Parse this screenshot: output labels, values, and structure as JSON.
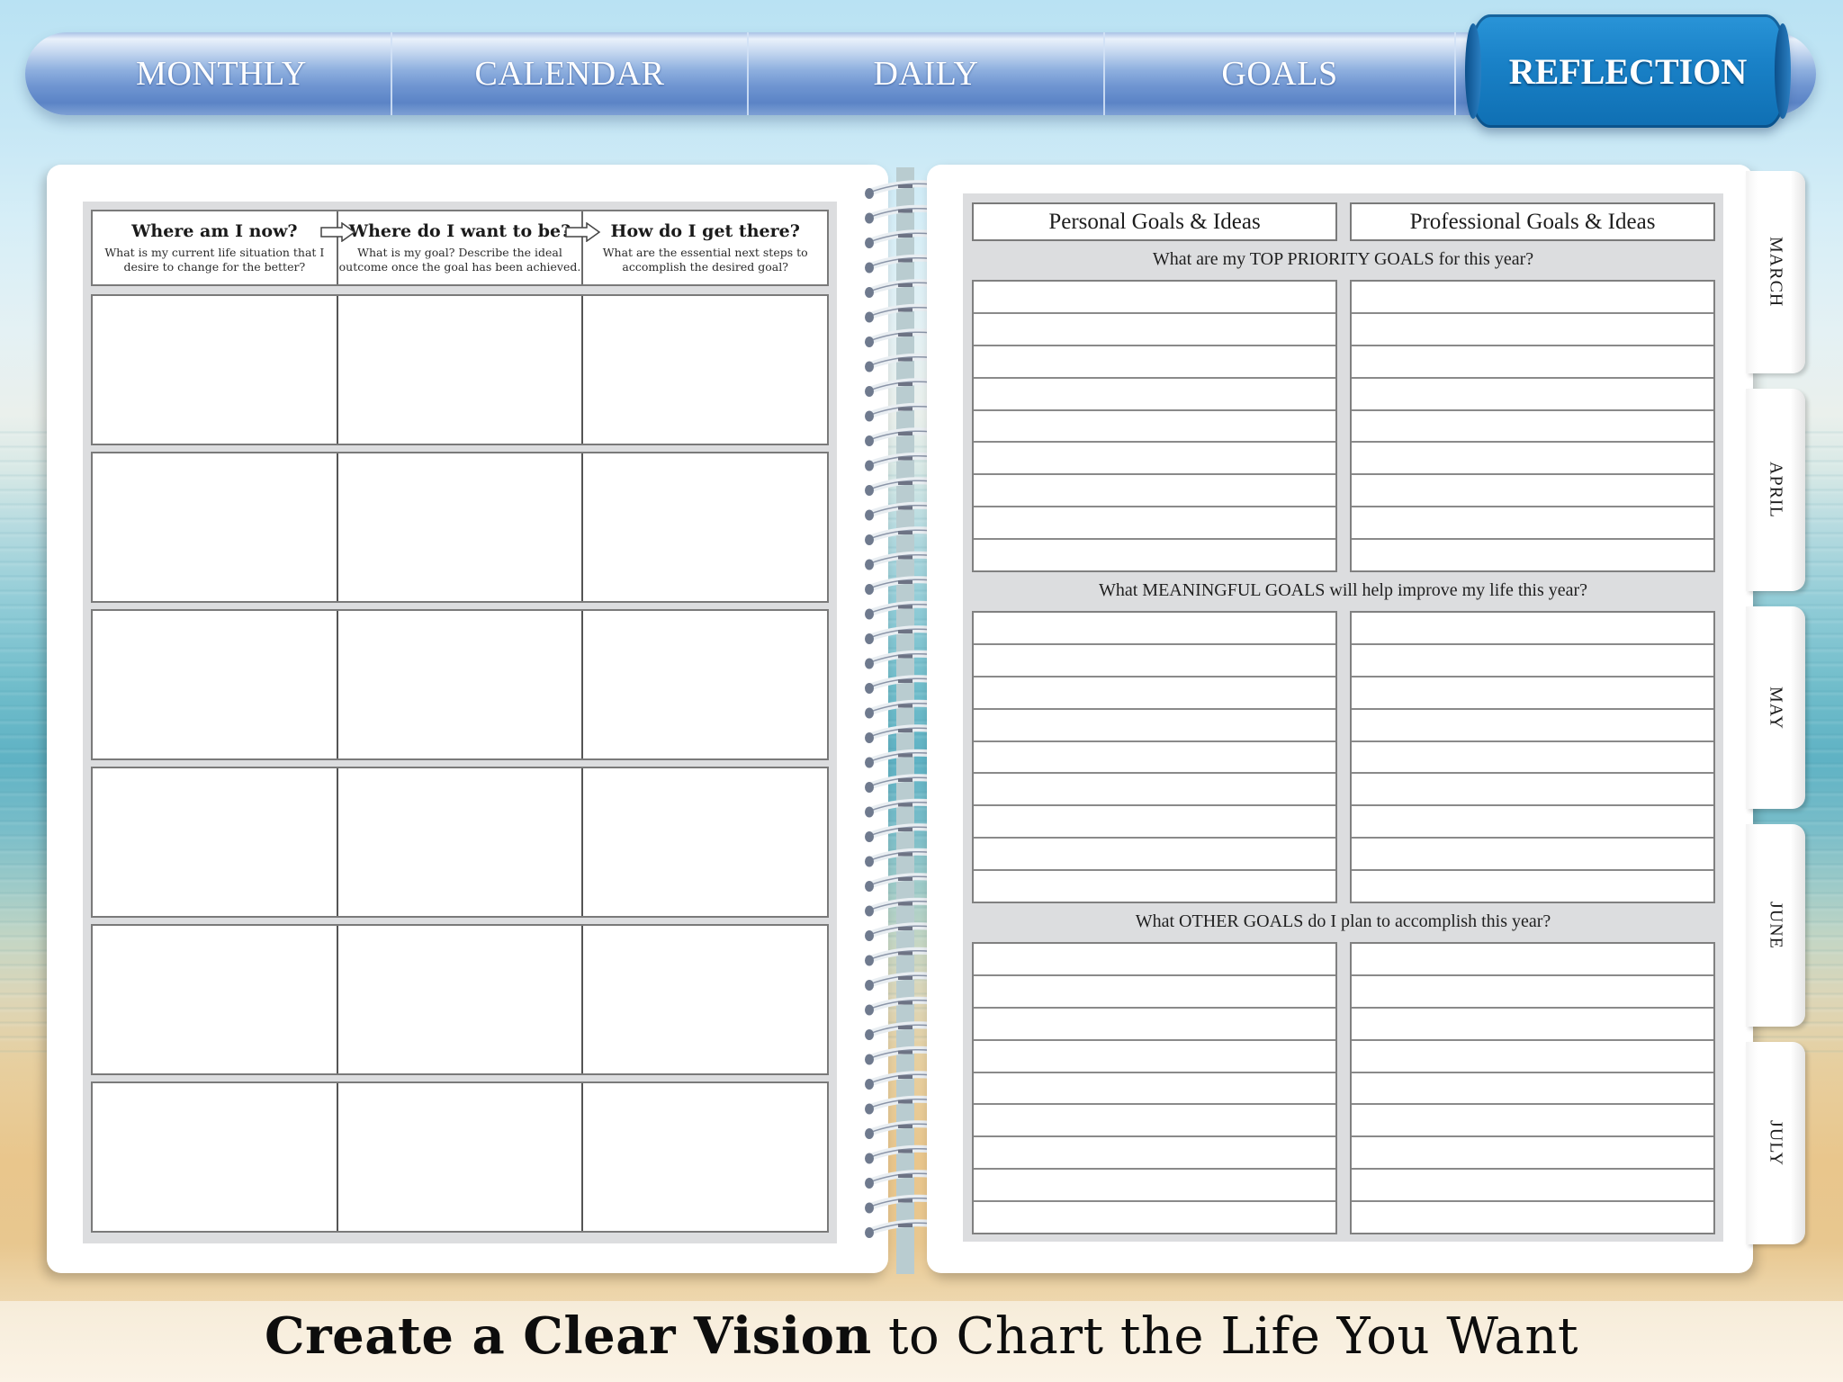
{
  "nav": {
    "tabs": [
      {
        "label": "MONTHLY",
        "active": false
      },
      {
        "label": "CALENDAR",
        "active": false
      },
      {
        "label": "DAILY",
        "active": false
      },
      {
        "label": "GOALS",
        "active": false
      },
      {
        "label": "REFLECTION",
        "active": true
      }
    ],
    "colors": {
      "bar": "#6f95d1",
      "active": "#1a82c8",
      "text": "#ffffff"
    }
  },
  "left_page": {
    "columns": [
      {
        "title": "Where am I now?",
        "subtitle": "What is my current life situation that I desire to change for the better?"
      },
      {
        "title": "Where do I want to be?",
        "subtitle": "What is my goal? Describe the ideal outcome once the goal has been achieved."
      },
      {
        "title": "How do I get there?",
        "subtitle": "What are the essential next steps to accomplish the desired goal?"
      }
    ],
    "row_count": 6
  },
  "right_page": {
    "column_headers": [
      "Personal Goals & Ideas",
      "Professional Goals & Ideas"
    ],
    "sections": [
      {
        "title": "What are my TOP PRIORITY GOALS for this year?",
        "line_count": 9
      },
      {
        "title": "What MEANINGFUL GOALS will help improve my life this year?",
        "line_count": 9
      },
      {
        "title": "What OTHER GOALS do I plan to accomplish this year?",
        "line_count": 9
      }
    ]
  },
  "month_tabs": [
    "MARCH",
    "APRIL",
    "MAY",
    "JUNE",
    "JULY"
  ],
  "caption": {
    "bold": "Create a Clear Vision",
    "regular": " to Chart the Life You Want"
  }
}
